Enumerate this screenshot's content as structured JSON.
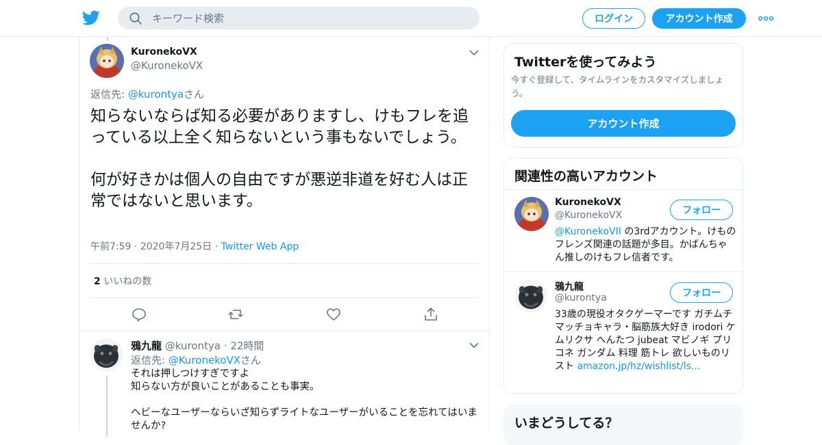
{
  "header": {
    "search_placeholder": "キーワード検索",
    "login_label": "ログイン",
    "signup_label": "アカウント作成"
  },
  "tweet": {
    "name": "KuronekoVX",
    "handle": "@KuronekoVX",
    "reply_prefix": "返信先: ",
    "reply_link": "@kurontya",
    "reply_suffix": "さん",
    "text": "知らないならば知る必要がありますし、けもフレを追っている以上全く知らないという事もないでしょう。\n\n何が好きかは個人の自由ですが悪逆非道を好む人は正常ではないと思います。",
    "time": "午前7:59",
    "date": "2020年7月25日",
    "source": "Twitter Web App",
    "likes_count": "2",
    "likes_label": "いいねの数"
  },
  "reply": {
    "name": "鴉九龍",
    "handle": "@kurontya",
    "time": "22時間",
    "reply_prefix": "返信先: ",
    "reply_link": "@KuronekoVX",
    "reply_suffix": "さん",
    "text": "それは押しつけすぎですよ\n知らない方が良いことがあることも事実。\n\nヘビーなユーザーならいざ知らずライトなユーザーがいることを忘れてはいませんか?"
  },
  "sidebar": {
    "try_title": "Twitterを使ってみよう",
    "try_desc": "今すぐ登録して、タイムラインをカスタマイズしましょう。",
    "try_button": "アカウント作成",
    "related_title": "関連性の高いアカウント",
    "accounts": [
      {
        "name": "KuronekoVX",
        "handle": "@KuronekoVX",
        "bio_link": "@KuronekoVII",
        "bio": " の3rdアカウント。けものフレンズ関連の話題が多目。かばんちゃん推しのけもフレ信者です。",
        "follow": "フォロー"
      },
      {
        "name": "鴉九龍",
        "handle": "@kurontya",
        "bio": "33歳の現役オタクゲーマーです ガチムチマッチョキャラ・脳筋族大好き irodori ケムリクサ へんたつ jubeat マビノギ プリコネ ガンダム 料理 筋トレ 欲しいものリスト ",
        "bio_link": "amazon.jp/hz/wishlist/ls...",
        "follow": "フォロー"
      }
    ],
    "trends_title": "いまどうしてる？"
  },
  "colors": {
    "accent": "#1da1f2",
    "link": "#1b95e0",
    "muted": "#657786"
  }
}
